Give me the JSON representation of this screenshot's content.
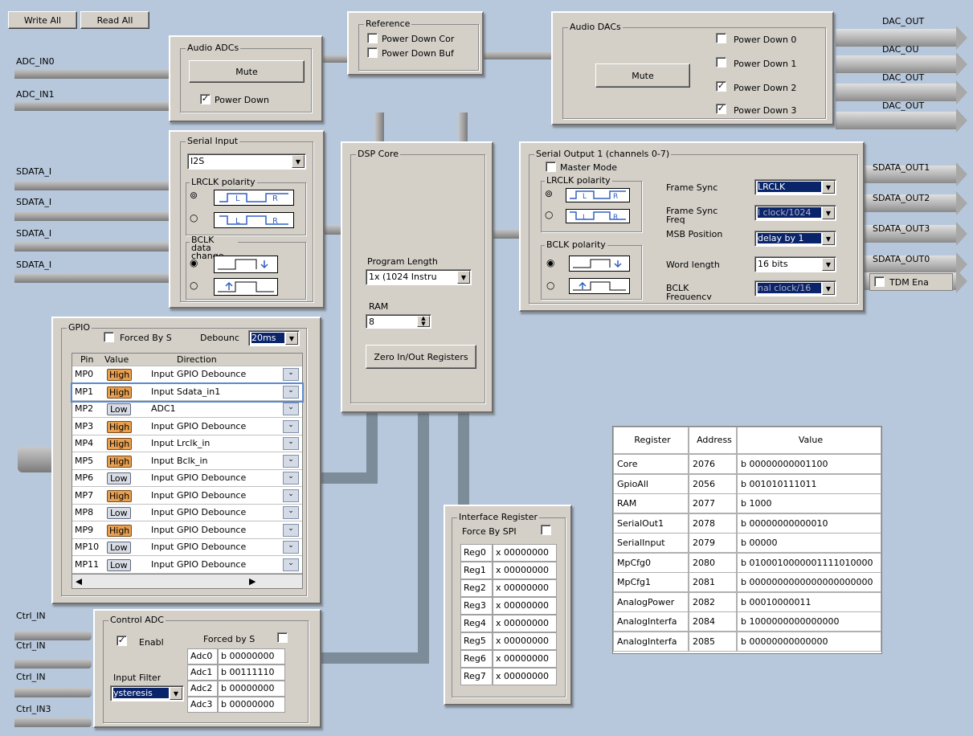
{
  "toolbar": {
    "write_all": "Write All",
    "read_all": "Read All"
  },
  "inputs": {
    "adc": [
      "ADC_IN0",
      "ADC_IN1"
    ],
    "sdata": [
      "SDATA_I",
      "SDATA_I",
      "SDATA_I",
      "SDATA_I"
    ],
    "ctrl": [
      "Ctrl_IN",
      "Ctrl_IN",
      "Ctrl_IN",
      "Ctrl_IN3"
    ]
  },
  "outputs": {
    "dac": [
      "DAC_OUT",
      "DAC_OU",
      "DAC_OUT",
      "DAC_OUT"
    ],
    "sdata": [
      "SDATA_OUT1",
      "SDATA_OUT2",
      "SDATA_OUT3",
      "SDATA_OUT0"
    ],
    "tdm": "TDM Ena"
  },
  "audio_adcs": {
    "title": "Audio ADCs",
    "mute": "Mute",
    "power_down": "Power Down",
    "power_down_checked": "✓"
  },
  "reference": {
    "title": "Reference",
    "items": [
      "Power Down Cor",
      "Power Down Buf"
    ]
  },
  "audio_dacs": {
    "title": "Audio DACs",
    "mute": "Mute",
    "power_down": [
      {
        "label": "Power Down 0",
        "check": ""
      },
      {
        "label": "Power Down 1",
        "check": ""
      },
      {
        "label": "Power Down 2",
        "check": "✓"
      },
      {
        "label": "Power Down 3",
        "check": "✓"
      }
    ]
  },
  "serial_input": {
    "title": "Serial Input",
    "format": "I2S",
    "lrclk": "LRCLK polarity",
    "bclk": "BCLK data change"
  },
  "dsp": {
    "title": "DSP Core",
    "program_length_label": "Program Length",
    "program_length": "1x (1024 Instru",
    "ram_label": "RAM",
    "ram": "8",
    "zero": "Zero In/Out Registers"
  },
  "serial_output": {
    "title": "Serial Output 1 (channels 0-7)",
    "master": "Master Mode",
    "lrclk": "LRCLK polarity",
    "bclk": "BCLK polarity",
    "frame_sync_label": "Frame Sync",
    "frame_sync": "LRCLK",
    "frame_sync_freq_label": "Frame Sync Freq",
    "frame_sync_freq": "l clock/1024",
    "msb_label": "MSB Position",
    "msb": "delay by 1",
    "word_label": "Word length",
    "word": "16 bits",
    "bclk_freq_label": "BCLK Frequency",
    "bclk_freq": "nal clock/16"
  },
  "gpio": {
    "title": "GPIO",
    "forced": "Forced By S",
    "debounce_label": "Debounc",
    "debounce": "20ms",
    "headers": [
      "Pin",
      "Value",
      "Direction"
    ],
    "rows": [
      {
        "pin": "MP0",
        "value": "High",
        "dir": "Input  GPIO Debounce"
      },
      {
        "pin": "MP1",
        "value": "High",
        "dir": "Input  Sdata_in1"
      },
      {
        "pin": "MP2",
        "value": "Low",
        "dir": "ADC1"
      },
      {
        "pin": "MP3",
        "value": "High",
        "dir": "Input  GPIO Debounce"
      },
      {
        "pin": "MP4",
        "value": "High",
        "dir": "Input  Lrclk_in"
      },
      {
        "pin": "MP5",
        "value": "High",
        "dir": "Input  Bclk_in"
      },
      {
        "pin": "MP6",
        "value": "Low",
        "dir": "Input  GPIO Debounce"
      },
      {
        "pin": "MP7",
        "value": "High",
        "dir": "Input  GPIO Debounce"
      },
      {
        "pin": "MP8",
        "value": "Low",
        "dir": "Input  GPIO Debounce"
      },
      {
        "pin": "MP9",
        "value": "High",
        "dir": "Input  GPIO Debounce"
      },
      {
        "pin": "MP10",
        "value": "Low",
        "dir": "Input  GPIO Debounce"
      },
      {
        "pin": "MP11",
        "value": "Low",
        "dir": "Input  GPIO Debounce"
      }
    ]
  },
  "control_adc": {
    "title": "Control ADC",
    "enable": "Enabl",
    "forced": "Forced by S",
    "filter_label": "Input Filter",
    "filter": "ysteresis",
    "rows": [
      {
        "name": "Adc0",
        "value": "b 00000000"
      },
      {
        "name": "Adc1",
        "value": "b 00111110"
      },
      {
        "name": "Adc2",
        "value": "b 00000000"
      },
      {
        "name": "Adc3",
        "value": "b 00000000"
      }
    ]
  },
  "interface": {
    "title": "Interface Register",
    "force": "Force By SPI",
    "rows": [
      {
        "name": "Reg0",
        "value": "x 00000000"
      },
      {
        "name": "Reg1",
        "value": "x 00000000"
      },
      {
        "name": "Reg2",
        "value": "x 00000000"
      },
      {
        "name": "Reg3",
        "value": "x 00000000"
      },
      {
        "name": "Reg4",
        "value": "x 00000000"
      },
      {
        "name": "Reg5",
        "value": "x 00000000"
      },
      {
        "name": "Reg6",
        "value": "x 00000000"
      },
      {
        "name": "Reg7",
        "value": "x 00000000"
      }
    ]
  },
  "registers": {
    "headers": [
      "Register",
      "Address",
      "Value"
    ],
    "rows": [
      {
        "name": "Core",
        "addr": "2076",
        "value": "b 00000000001100"
      },
      {
        "name": "GpioAll",
        "addr": "2056",
        "value": "b 001010111011"
      },
      {
        "name": "RAM",
        "addr": "2077",
        "value": "b 1000"
      },
      {
        "name": "SerialOut1",
        "addr": "2078",
        "value": "b 00000000000010"
      },
      {
        "name": "SerialInput",
        "addr": "2079",
        "value": "b 00000"
      },
      {
        "name": "MpCfg0",
        "addr": "2080",
        "value": "b 0100010000001111010000"
      },
      {
        "name": "MpCfg1",
        "addr": "2081",
        "value": "b 0000000000000000000000"
      },
      {
        "name": "AnalogPower",
        "addr": "2082",
        "value": "b 00010000011"
      },
      {
        "name": "AnalogInterfa",
        "addr": "2084",
        "value": "b 1000000000000000"
      },
      {
        "name": "AnalogInterfa",
        "addr": "2085",
        "value": "b 00000000000000"
      }
    ]
  }
}
